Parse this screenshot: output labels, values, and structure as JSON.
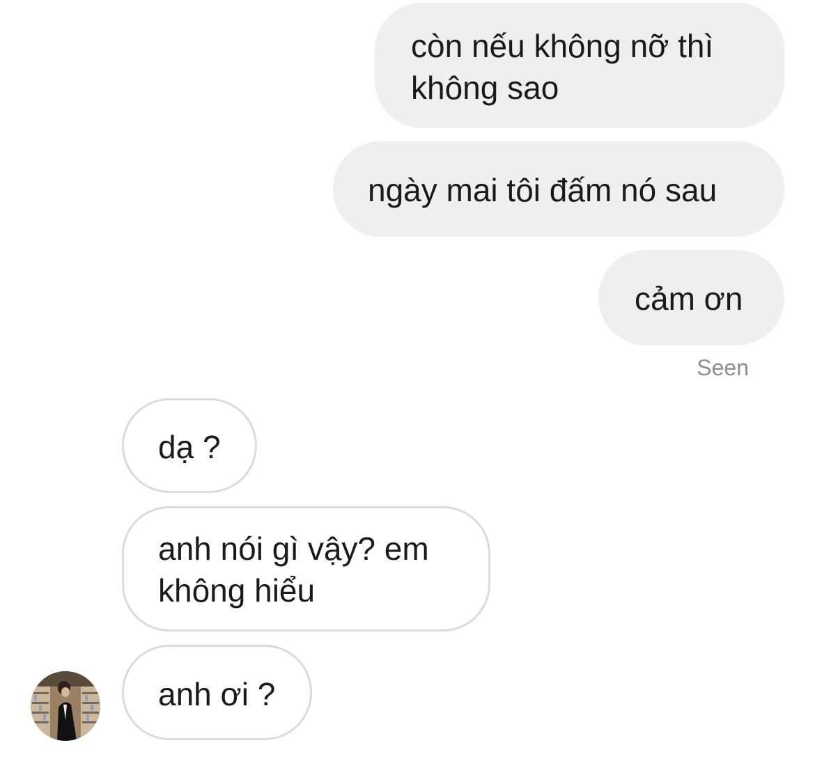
{
  "messages": [
    {
      "direction": "sent",
      "text": "còn nếu không nỡ thì\nkhông sao"
    },
    {
      "direction": "sent",
      "text": "ngày mai tôi đấm nó sau"
    },
    {
      "direction": "sent",
      "text": "cảm ơn"
    },
    {
      "direction": "received",
      "text": "dạ ?"
    },
    {
      "direction": "received",
      "text": "anh nói gì vậy? em\nkhông hiểu"
    },
    {
      "direction": "received",
      "text": "anh ơi ?"
    }
  ],
  "status": {
    "seen_label": "Seen"
  },
  "avatar": {
    "icon": "contact-avatar-photo"
  }
}
